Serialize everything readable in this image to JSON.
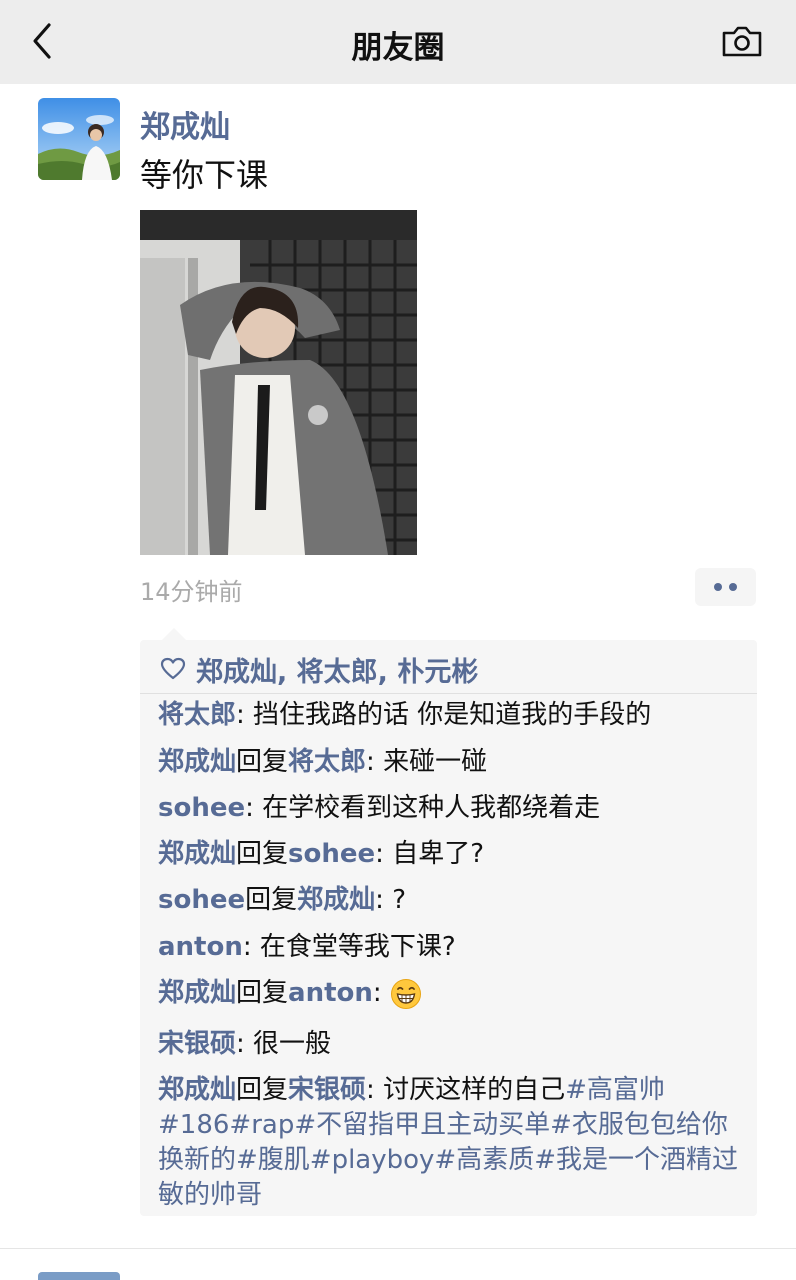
{
  "nav": {
    "title": "朋友圈"
  },
  "post": {
    "author": "郑成灿",
    "text": "等你下课",
    "time": "14分钟前"
  },
  "likes": {
    "names": "郑成灿, 将太郎, 朴元彬"
  },
  "comments": [
    {
      "from": "将太郎",
      "sep": ": ",
      "text": "挡住我路的话 你是知道我的手段的"
    },
    {
      "from": "郑成灿",
      "reply_word": "回复",
      "to": "将太郎",
      "sep": ": ",
      "text": "来碰一碰"
    },
    {
      "from": "sohee",
      "sep": ": ",
      "text": "在学校看到这种人我都绕着走"
    },
    {
      "from": "郑成灿",
      "reply_word": "回复",
      "to": "sohee",
      "sep": ": ",
      "text": "自卑了?"
    },
    {
      "from": "sohee",
      "reply_word": "回复",
      "to": "郑成灿",
      "sep": ": ",
      "text": "?"
    },
    {
      "from": "anton",
      "sep": ": ",
      "text": "在食堂等我下课?"
    },
    {
      "from": "郑成灿",
      "reply_word": "回复",
      "to": "anton",
      "sep": ": ",
      "emoji": "grinning-face-emoji"
    },
    {
      "from": "宋银硕",
      "sep": ": ",
      "text": "很一般"
    },
    {
      "from": "郑成灿",
      "reply_word": "回复",
      "to": "宋银硕",
      "sep": ": ",
      "text": "讨厌这样的自己",
      "tags": "#高富帅#186#rap#不留指甲且主动买单#衣服包包给你换新的#腹肌#playboy#高素质#我是一个酒精过敏的帅哥"
    }
  ],
  "colors": {
    "name_blue": "#576b95",
    "nav_bg": "#ededed",
    "comment_bg": "#f6f6f6",
    "time_gray": "#aaaaaa"
  },
  "icons": [
    "back-chevron-icon",
    "camera-icon",
    "heart-outline-icon",
    "more-dots-icon"
  ]
}
